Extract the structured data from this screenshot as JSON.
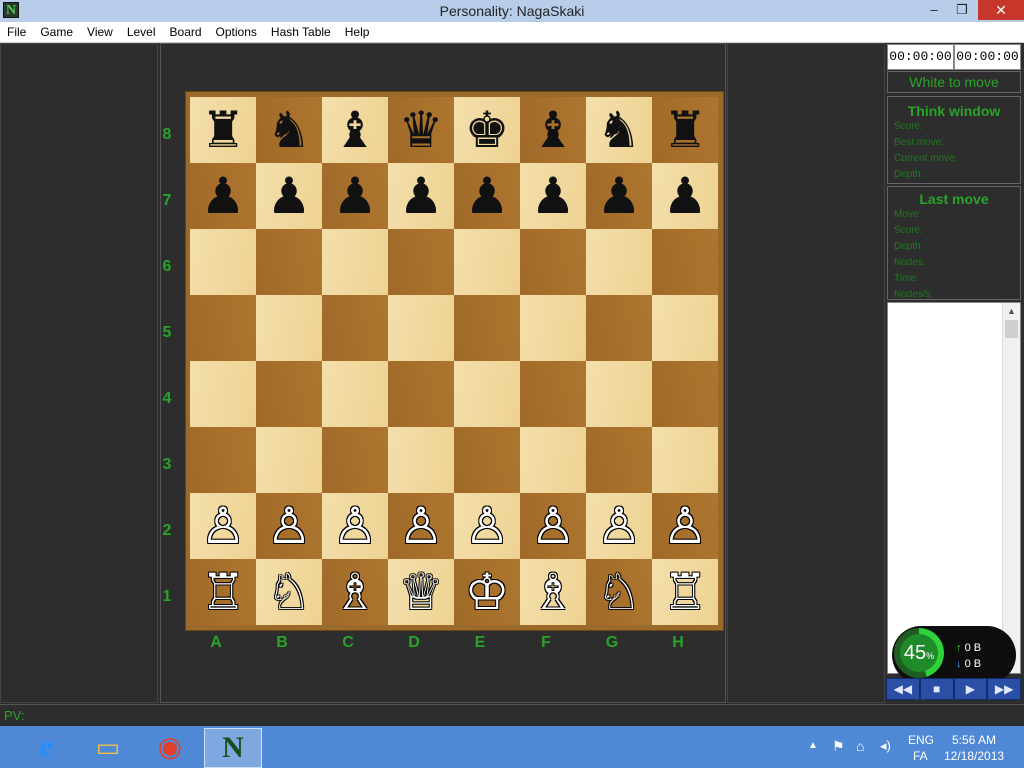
{
  "window": {
    "title": "Personality: NagaSkaki",
    "app_icon": "N",
    "controls": {
      "minimize": "–",
      "maximize": "❐",
      "close": "✕"
    }
  },
  "menu": [
    "File",
    "Game",
    "View",
    "Level",
    "Board",
    "Options",
    "Hash Table",
    "Help"
  ],
  "board": {
    "ranks": [
      "8",
      "7",
      "6",
      "5",
      "4",
      "3",
      "2",
      "1"
    ],
    "files": [
      "A",
      "B",
      "C",
      "D",
      "E",
      "F",
      "G",
      "H"
    ],
    "rows": [
      [
        "♜",
        "♞",
        "♝",
        "♛",
        "♚",
        "♝",
        "♞",
        "♜"
      ],
      [
        "♟",
        "♟",
        "♟",
        "♟",
        "♟",
        "♟",
        "♟",
        "♟"
      ],
      [
        "",
        "",
        "",
        "",
        "",
        "",
        "",
        ""
      ],
      [
        "",
        "",
        "",
        "",
        "",
        "",
        "",
        ""
      ],
      [
        "",
        "",
        "",
        "",
        "",
        "",
        "",
        ""
      ],
      [
        "",
        "",
        "",
        "",
        "",
        "",
        "",
        ""
      ],
      [
        "♙",
        "♙",
        "♙",
        "♙",
        "♙",
        "♙",
        "♙",
        "♙"
      ],
      [
        "♖",
        "♘",
        "♗",
        "♕",
        "♔",
        "♗",
        "♘",
        "♖"
      ]
    ],
    "colors": {
      "light_square": "#f2d99c",
      "dark_square": "#a9722d",
      "frame": "#9a6a2a",
      "coordinates": "#29a329"
    }
  },
  "clocks": {
    "white": "00:00:00",
    "black": "00:00:00"
  },
  "status": "White to move",
  "think_window": {
    "title": "Think window",
    "fields": [
      "Score:",
      "Best move:",
      "Current move:",
      "Depth:"
    ]
  },
  "last_move": {
    "title": "Last move",
    "fields": [
      "Move:",
      "Score:",
      "Depth:",
      "Nodes:",
      "Time:",
      "Nodes/s:"
    ]
  },
  "net_meter": {
    "percent": "45",
    "percent_sign": "%",
    "upload": "0 B",
    "download": "0 B",
    "up_arrow": "↑",
    "down_arrow": "↓"
  },
  "navigation": [
    "◀◀",
    "■",
    "▶",
    "▶▶"
  ],
  "pv": {
    "label": "PV:"
  },
  "taskbar": {
    "apps": [
      {
        "icon": "internet-explorer-icon",
        "glyph": "e"
      },
      {
        "icon": "file-explorer-icon",
        "glyph": "▭"
      },
      {
        "icon": "chrome-icon",
        "glyph": "◉"
      },
      {
        "icon": "nagaskaki-icon",
        "glyph": "N"
      }
    ],
    "tray": {
      "tray_up": "▲",
      "flag": "⚑",
      "network": "⌂",
      "volume": "◂)",
      "lang_line1": "ENG",
      "lang_line2": "FA",
      "time": "5:56 AM",
      "date": "12/18/2013"
    }
  }
}
